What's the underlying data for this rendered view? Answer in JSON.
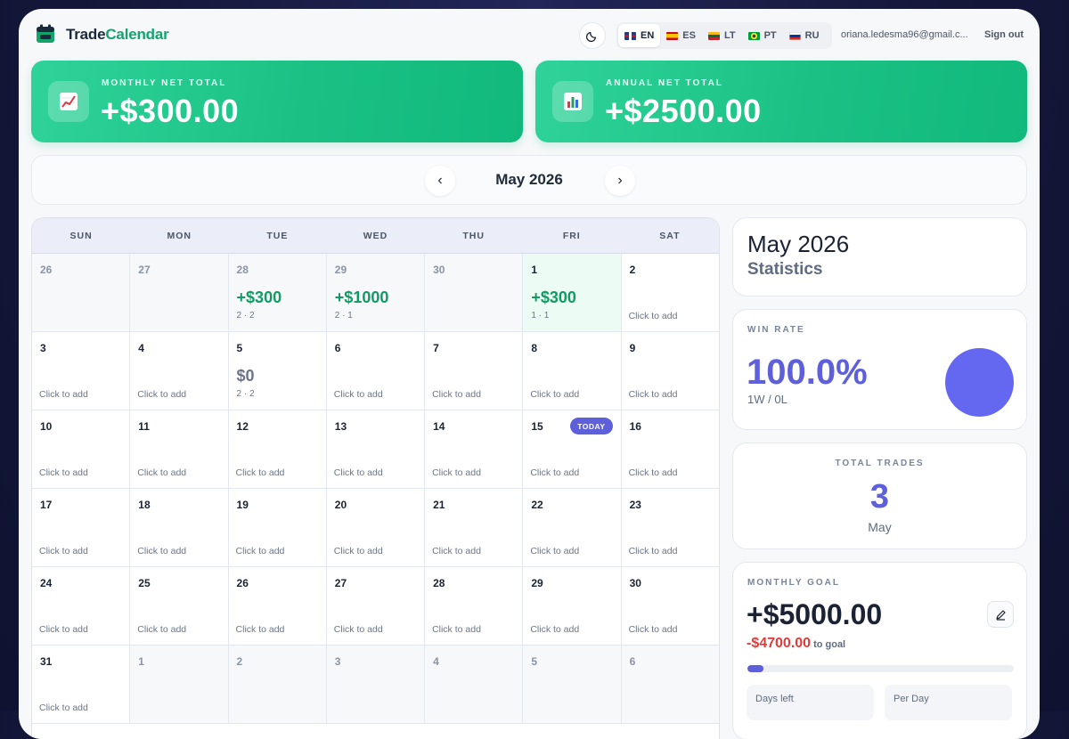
{
  "header": {
    "brand_part1": "Trade",
    "brand_part2": "Calendar",
    "languages": [
      {
        "code": "EN",
        "active": true
      },
      {
        "code": "ES",
        "active": false
      },
      {
        "code": "LT",
        "active": false
      },
      {
        "code": "PT",
        "active": false
      },
      {
        "code": "RU",
        "active": false
      }
    ],
    "user_email": "oriana.ledesma96@gmail.c...",
    "sign_out": "Sign out"
  },
  "totals": {
    "monthly_label": "MONTHLY NET TOTAL",
    "monthly_value": "+$300.00",
    "annual_label": "ANNUAL NET TOTAL",
    "annual_value": "+$2500.00"
  },
  "month_nav": {
    "prev": "‹",
    "title": "May 2026",
    "next": "›"
  },
  "calendar": {
    "weekdays": [
      "SUN",
      "MON",
      "TUE",
      "WED",
      "THU",
      "FRI",
      "SAT"
    ],
    "today_badge": "TODAY",
    "days": [
      {
        "n": "26",
        "out": true
      },
      {
        "n": "27",
        "out": true
      },
      {
        "n": "28",
        "out": true,
        "pnl": "+$300",
        "meta": "2 · 2"
      },
      {
        "n": "29",
        "out": true,
        "pnl": "+$1000",
        "meta": "2 · 1"
      },
      {
        "n": "30",
        "out": true
      },
      {
        "n": "1",
        "green": true,
        "pnl": "+$300",
        "meta": "1 · 1"
      },
      {
        "n": "2",
        "add": "Click to add"
      },
      {
        "n": "3",
        "add": "Click to add"
      },
      {
        "n": "4",
        "add": "Click to add"
      },
      {
        "n": "5",
        "pnl": "$0",
        "zero": true,
        "meta": "2 · 2"
      },
      {
        "n": "6",
        "add": "Click to add"
      },
      {
        "n": "7",
        "add": "Click to add"
      },
      {
        "n": "8",
        "add": "Click to add"
      },
      {
        "n": "9",
        "add": "Click to add"
      },
      {
        "n": "10",
        "add": "Click to add"
      },
      {
        "n": "11",
        "add": "Click to add"
      },
      {
        "n": "12",
        "add": "Click to add"
      },
      {
        "n": "13",
        "add": "Click to add"
      },
      {
        "n": "14",
        "add": "Click to add"
      },
      {
        "n": "15",
        "today": true,
        "add": "Click to add"
      },
      {
        "n": "16",
        "add": "Click to add"
      },
      {
        "n": "17",
        "add": "Click to add"
      },
      {
        "n": "18",
        "add": "Click to add"
      },
      {
        "n": "19",
        "add": "Click to add"
      },
      {
        "n": "20",
        "add": "Click to add"
      },
      {
        "n": "21",
        "add": "Click to add"
      },
      {
        "n": "22",
        "add": "Click to add"
      },
      {
        "n": "23",
        "add": "Click to add"
      },
      {
        "n": "24",
        "add": "Click to add"
      },
      {
        "n": "25",
        "add": "Click to add"
      },
      {
        "n": "26",
        "add": "Click to add"
      },
      {
        "n": "27",
        "add": "Click to add"
      },
      {
        "n": "28",
        "add": "Click to add"
      },
      {
        "n": "29",
        "add": "Click to add"
      },
      {
        "n": "30",
        "add": "Click to add"
      },
      {
        "n": "31",
        "add": "Click to add"
      },
      {
        "n": "1",
        "out": true
      },
      {
        "n": "2",
        "out": true
      },
      {
        "n": "3",
        "out": true
      },
      {
        "n": "4",
        "out": true
      },
      {
        "n": "5",
        "out": true
      },
      {
        "n": "6",
        "out": true
      }
    ]
  },
  "stats": {
    "title": "May 2026",
    "subtitle": "Statistics",
    "win_rate_label": "WIN RATE",
    "win_rate_value": "100.0%",
    "win_rate_sub": "1W / 0L",
    "total_trades_label": "TOTAL TRADES",
    "total_trades_value": "3",
    "total_trades_sub": "May",
    "goal_label": "MONTHLY GOAL",
    "goal_value": "+$5000.00",
    "goal_remaining": "-$4700.00",
    "goal_remaining_suffix": "to goal",
    "goal_progress_fraction": 0.06,
    "days_left_label": "Days left",
    "per_day_label": "Per Day"
  },
  "colors": {
    "accent_green": "#12b97c",
    "accent_purple": "#5d5fdb",
    "negative_red": "#e53939"
  },
  "icons": {
    "logo": "calendar-logo-icon",
    "theme": "moon-icon",
    "monthly": "chart-increasing-icon",
    "annual": "bar-chart-icon",
    "edit": "pencil-icon"
  }
}
